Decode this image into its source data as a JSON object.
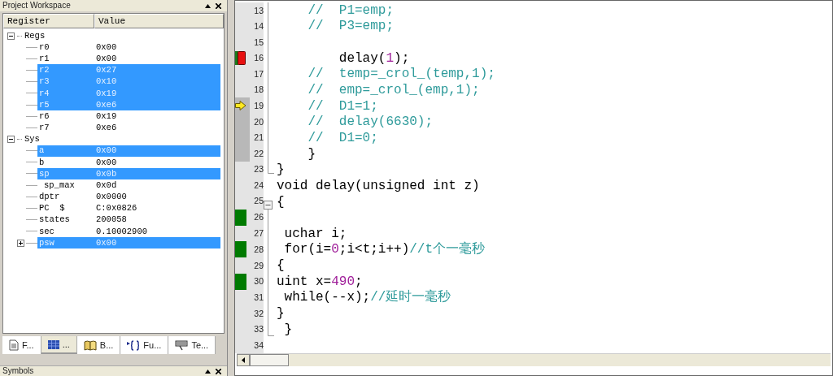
{
  "workspace": {
    "title": "Project Workspace",
    "columns": [
      "Register",
      "Value"
    ],
    "groups": [
      {
        "name": "Regs",
        "expanded": true,
        "items": [
          {
            "name": "r0",
            "value": "0x00",
            "selected": false,
            "kind": "leaf"
          },
          {
            "name": "r1",
            "value": "0x00",
            "selected": false,
            "kind": "leaf"
          },
          {
            "name": "r2",
            "value": "0x27",
            "selected": true,
            "kind": "leaf"
          },
          {
            "name": "r3",
            "value": "0x10",
            "selected": true,
            "kind": "leaf"
          },
          {
            "name": "r4",
            "value": "0x19",
            "selected": true,
            "kind": "leaf"
          },
          {
            "name": "r5",
            "value": "0xe6",
            "selected": true,
            "kind": "leaf"
          },
          {
            "name": "r6",
            "value": "0x19",
            "selected": false,
            "kind": "leaf"
          },
          {
            "name": "r7",
            "value": "0xe6",
            "selected": false,
            "kind": "leaf"
          }
        ]
      },
      {
        "name": "Sys",
        "expanded": true,
        "items": [
          {
            "name": "a",
            "value": "0x00",
            "selected": true,
            "kind": "leaf"
          },
          {
            "name": "b",
            "value": "0x00",
            "selected": false,
            "kind": "leaf"
          },
          {
            "name": "sp",
            "value": "0x0b",
            "selected": true,
            "kind": "leaf"
          },
          {
            "name": "sp_max",
            "value": "0x0d",
            "selected": false,
            "kind": "sub"
          },
          {
            "name": "dptr",
            "value": "0x0000",
            "selected": false,
            "kind": "leaf"
          },
          {
            "name": "PC  $",
            "value": "C:0x0826",
            "selected": false,
            "kind": "leaf"
          },
          {
            "name": "states",
            "value": "200058",
            "selected": false,
            "kind": "leaf"
          },
          {
            "name": "sec",
            "value": "0.10002900",
            "selected": false,
            "kind": "leaf"
          },
          {
            "name": "psw",
            "value": "0x00",
            "selected": true,
            "kind": "collapsed"
          }
        ]
      }
    ],
    "tabs": [
      {
        "label": "F...",
        "selected": false
      },
      {
        "label": "...",
        "selected": true
      },
      {
        "label": "B...",
        "selected": false
      },
      {
        "label": "Fu...",
        "selected": false
      },
      {
        "label": "Te...",
        "selected": false
      }
    ]
  },
  "symbols": {
    "title": "Symbols"
  },
  "editor": {
    "lines": [
      {
        "number": "13",
        "breakpoint": false,
        "current": false,
        "executed": false,
        "shaded": false,
        "segments": [
          {
            "kind": "comment",
            "text": "    //  P1=emp;"
          }
        ]
      },
      {
        "number": "14",
        "breakpoint": false,
        "current": false,
        "executed": false,
        "shaded": false,
        "segments": [
          {
            "kind": "comment",
            "text": "    //  P3=emp;"
          }
        ]
      },
      {
        "number": "15",
        "breakpoint": false,
        "current": false,
        "executed": false,
        "shaded": false
      },
      {
        "number": "16",
        "breakpoint": true,
        "current": false,
        "executed": true,
        "shaded": false,
        "segments": [
          {
            "kind": "plain",
            "text": "        delay("
          },
          {
            "kind": "number",
            "text": "1"
          },
          {
            "kind": "plain",
            "text": ");"
          }
        ]
      },
      {
        "number": "17",
        "breakpoint": false,
        "current": false,
        "executed": false,
        "shaded": false,
        "segments": [
          {
            "kind": "comment",
            "text": "    //  temp=_crol_(temp,1);"
          }
        ]
      },
      {
        "number": "18",
        "breakpoint": false,
        "current": false,
        "executed": false,
        "shaded": false,
        "segments": [
          {
            "kind": "comment",
            "text": "    //  emp=_crol_(emp,1);"
          }
        ]
      },
      {
        "number": "19",
        "breakpoint": false,
        "current": true,
        "executed": false,
        "shaded": true,
        "segments": [
          {
            "kind": "comment",
            "text": "    //  D1=1;"
          }
        ]
      },
      {
        "number": "20",
        "breakpoint": false,
        "current": false,
        "executed": false,
        "shaded": true,
        "segments": [
          {
            "kind": "comment",
            "text": "    //  delay(6630);"
          }
        ]
      },
      {
        "number": "21",
        "breakpoint": false,
        "current": false,
        "executed": false,
        "shaded": true,
        "segments": [
          {
            "kind": "comment",
            "text": "    //  D1=0;"
          }
        ]
      },
      {
        "number": "22",
        "breakpoint": false,
        "current": false,
        "executed": false,
        "shaded": true,
        "segments": [
          {
            "kind": "plain",
            "text": "    }"
          }
        ]
      },
      {
        "number": "23",
        "breakpoint": false,
        "current": false,
        "executed": false,
        "shaded": false,
        "segments": [
          {
            "kind": "plain",
            "text": "}"
          }
        ]
      },
      {
        "number": "24",
        "breakpoint": false,
        "current": false,
        "executed": false,
        "shaded": false,
        "segments": [
          {
            "kind": "plain",
            "text": "void delay(unsigned int z)"
          }
        ]
      },
      {
        "number": "25",
        "breakpoint": false,
        "current": false,
        "executed": false,
        "shaded": false,
        "segments": [
          {
            "kind": "plain",
            "text": "{"
          }
        ]
      },
      {
        "number": "26",
        "breakpoint": false,
        "current": false,
        "executed": true,
        "shaded": false
      },
      {
        "number": "27",
        "breakpoint": false,
        "current": false,
        "executed": false,
        "shaded": false,
        "segments": [
          {
            "kind": "plain",
            "text": " uchar i;"
          }
        ]
      },
      {
        "number": "28",
        "breakpoint": false,
        "current": false,
        "executed": true,
        "shaded": false,
        "segments": [
          {
            "kind": "plain",
            "text": " for(i="
          },
          {
            "kind": "number",
            "text": "0"
          },
          {
            "kind": "plain",
            "text": ";i<t;i++)"
          },
          {
            "kind": "comment",
            "text": "//t个一毫秒"
          }
        ]
      },
      {
        "number": "29",
        "breakpoint": false,
        "current": false,
        "executed": false,
        "shaded": false,
        "segments": [
          {
            "kind": "plain",
            "text": "{"
          }
        ]
      },
      {
        "number": "30",
        "breakpoint": false,
        "current": false,
        "executed": true,
        "shaded": false,
        "segments": [
          {
            "kind": "plain",
            "text": "uint x="
          },
          {
            "kind": "number",
            "text": "490"
          },
          {
            "kind": "plain",
            "text": ";"
          }
        ]
      },
      {
        "number": "31",
        "breakpoint": false,
        "current": false,
        "executed": false,
        "shaded": false,
        "segments": [
          {
            "kind": "plain",
            "text": " while(--x);"
          },
          {
            "kind": "comment",
            "text": "//延时一毫秒"
          }
        ]
      },
      {
        "number": "32",
        "breakpoint": false,
        "current": false,
        "executed": false,
        "shaded": false,
        "segments": [
          {
            "kind": "plain",
            "text": "}"
          }
        ]
      },
      {
        "number": "33",
        "breakpoint": false,
        "current": false,
        "executed": false,
        "shaded": false,
        "segments": [
          {
            "kind": "plain",
            "text": " }"
          }
        ]
      },
      {
        "number": "34",
        "breakpoint": false,
        "current": false,
        "executed": false,
        "shaded": false
      }
    ]
  }
}
